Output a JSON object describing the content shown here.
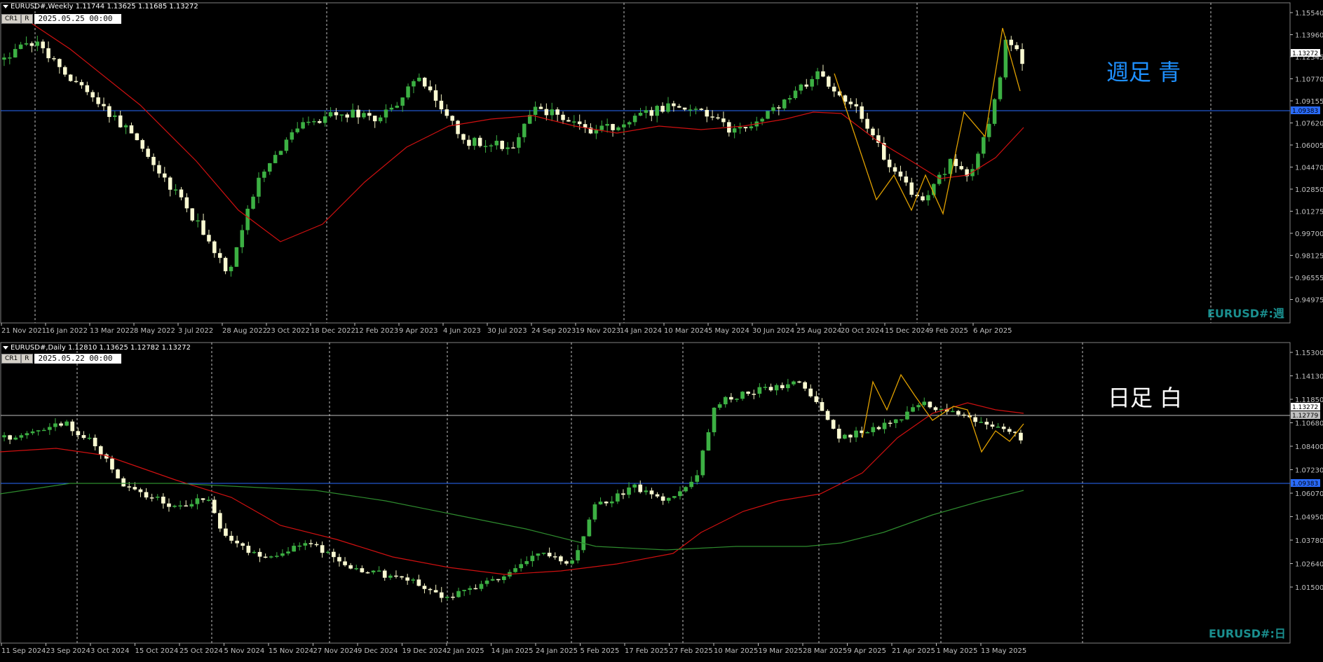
{
  "weekly": {
    "header": "EURUSD#,Weekly  1.11744 1.13625 1.11685 1.13272",
    "ctrl_cr": "CR1",
    "ctrl_r": "R",
    "datetime": "2025.05.25 00:00",
    "label": "週足  青",
    "label_color": "#1e90ff",
    "watermark": "EURUSD#:週",
    "price_axis": [
      "1.15540",
      "1.13960",
      "1.12345",
      "1.10770",
      "1.09155",
      "1.07620",
      "1.06005",
      "1.04470",
      "1.02850",
      "1.01275",
      "0.99700",
      "0.98125",
      "0.96555",
      "0.94975"
    ],
    "current_price": "1.13272",
    "hline_price": "1.09383",
    "hline_color": "#2a6cff",
    "date_axis": [
      "21 Nov 2021",
      "16 Jan 2022",
      "13 Mar 2022",
      "8 May 2022",
      "3 Jul 2022",
      "28 Aug 2022",
      "23 Oct 2022",
      "18 Dec 2022",
      "12 Feb 2023",
      "9 Apr 2023",
      "4 Jun 2023",
      "30 Jul 2023",
      "24 Sep 2023",
      "19 Nov 2023",
      "14 Jan 2024",
      "10 Mar 2024",
      "5 May 2024",
      "30 Jun 2024",
      "25 Aug 2024",
      "20 Oct 2024",
      "15 Dec 2024",
      "9 Feb 2025",
      "6 Apr 2025"
    ],
    "ma_color": "#d01010",
    "zigzag_color": "#e0a000"
  },
  "daily": {
    "header": "EURUSD#,Daily  1.12810 1.13625 1.12782 1.13272",
    "ctrl_cr": "CR1",
    "ctrl_r": "R",
    "datetime": "2025.05.22 00:00",
    "label": "日足  白",
    "label_color": "#ffffff",
    "watermark": "EURUSD#:日",
    "price_axis": [
      "1.15300",
      "1.14130",
      "1.11850",
      "1.10680",
      "1.08400",
      "1.07230",
      "1.06070",
      "1.04950",
      "1.03780",
      "1.02640",
      "1.01500"
    ],
    "current_price": "1.13272",
    "hline_price_white": "1.12779",
    "hline_price_blue": "1.09383",
    "hline_color": "#2a6cff",
    "date_axis": [
      "11 Sep 2024",
      "23 Sep 2024",
      "3 Oct 2024",
      "15 Oct 2024",
      "25 Oct 2024",
      "5 Nov 2024",
      "15 Nov 2024",
      "27 Nov 2024",
      "9 Dec 2024",
      "19 Dec 2024",
      "2 Jan 2025",
      "14 Jan 2025",
      "24 Jan 2025",
      "5 Feb 2025",
      "17 Feb 2025",
      "27 Feb 2025",
      "10 Mar 2025",
      "19 Mar 2025",
      "28 Mar 2025",
      "9 Apr 2025",
      "21 Apr 2025",
      "1 May 2025",
      "13 May 2025"
    ],
    "ma_color": "#d01010",
    "ma2_color": "#2e8b2e",
    "zigzag_color": "#e0a000"
  }
}
